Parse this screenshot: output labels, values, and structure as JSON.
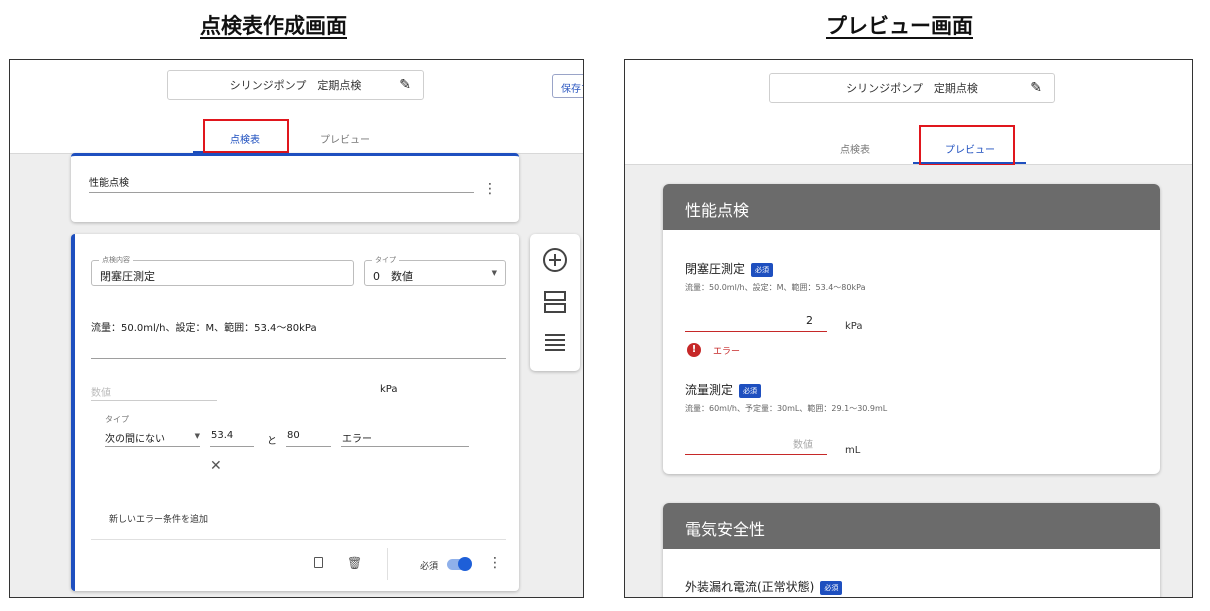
{
  "headings": {
    "editor": "点検表作成画面",
    "preview": "プレビュー画面"
  },
  "editor": {
    "title": "シリンジポンプ　定期点検",
    "save_label": "保存す",
    "tabs": [
      "点検表",
      "プレビュー"
    ],
    "section_title": "性能点検",
    "item": {
      "content_legend": "点検内容",
      "content_value": "閉塞圧測定",
      "type_legend": "タイプ",
      "type_value": "0　数値",
      "description": "流量：50.0ml/h、設定：M、範囲：53.4～80kPa",
      "value_placeholder": "数値",
      "unit": "kPa",
      "cond_type_label": "タイプ",
      "cond_type_value": "次の間にない",
      "cond_min": "53.4",
      "cond_and": "と",
      "cond_max": "80",
      "cond_message": "エラー",
      "add_condition": "新しいエラー条件を追加",
      "required_label": "必須"
    }
  },
  "preview": {
    "title": "シリンジポンプ　定期点検",
    "tabs": [
      "点検表",
      "プレビュー"
    ],
    "section1": {
      "title": "性能点検",
      "item1": {
        "label": "閉塞圧測定",
        "badge": "必須",
        "desc": "流量：50.0ml/h、設定：M、範囲：53.4～80kPa",
        "value": "2",
        "unit": "kPa",
        "error": "エラー"
      },
      "item2": {
        "label": "流量測定",
        "badge": "必須",
        "desc": "流量：60ml/h、予定量：30mL、範囲：29.1～30.9mL",
        "placeholder": "数値",
        "unit": "mL"
      }
    },
    "section2": {
      "title": "電気安全性",
      "item1": {
        "label": "外装漏れ電流(正常状態)",
        "badge": "必須"
      }
    }
  },
  "colors": {
    "accent": "#1e4fbf",
    "highlight": "#e0161d",
    "error": "#c62828",
    "header_gray": "#6b6b6b"
  }
}
